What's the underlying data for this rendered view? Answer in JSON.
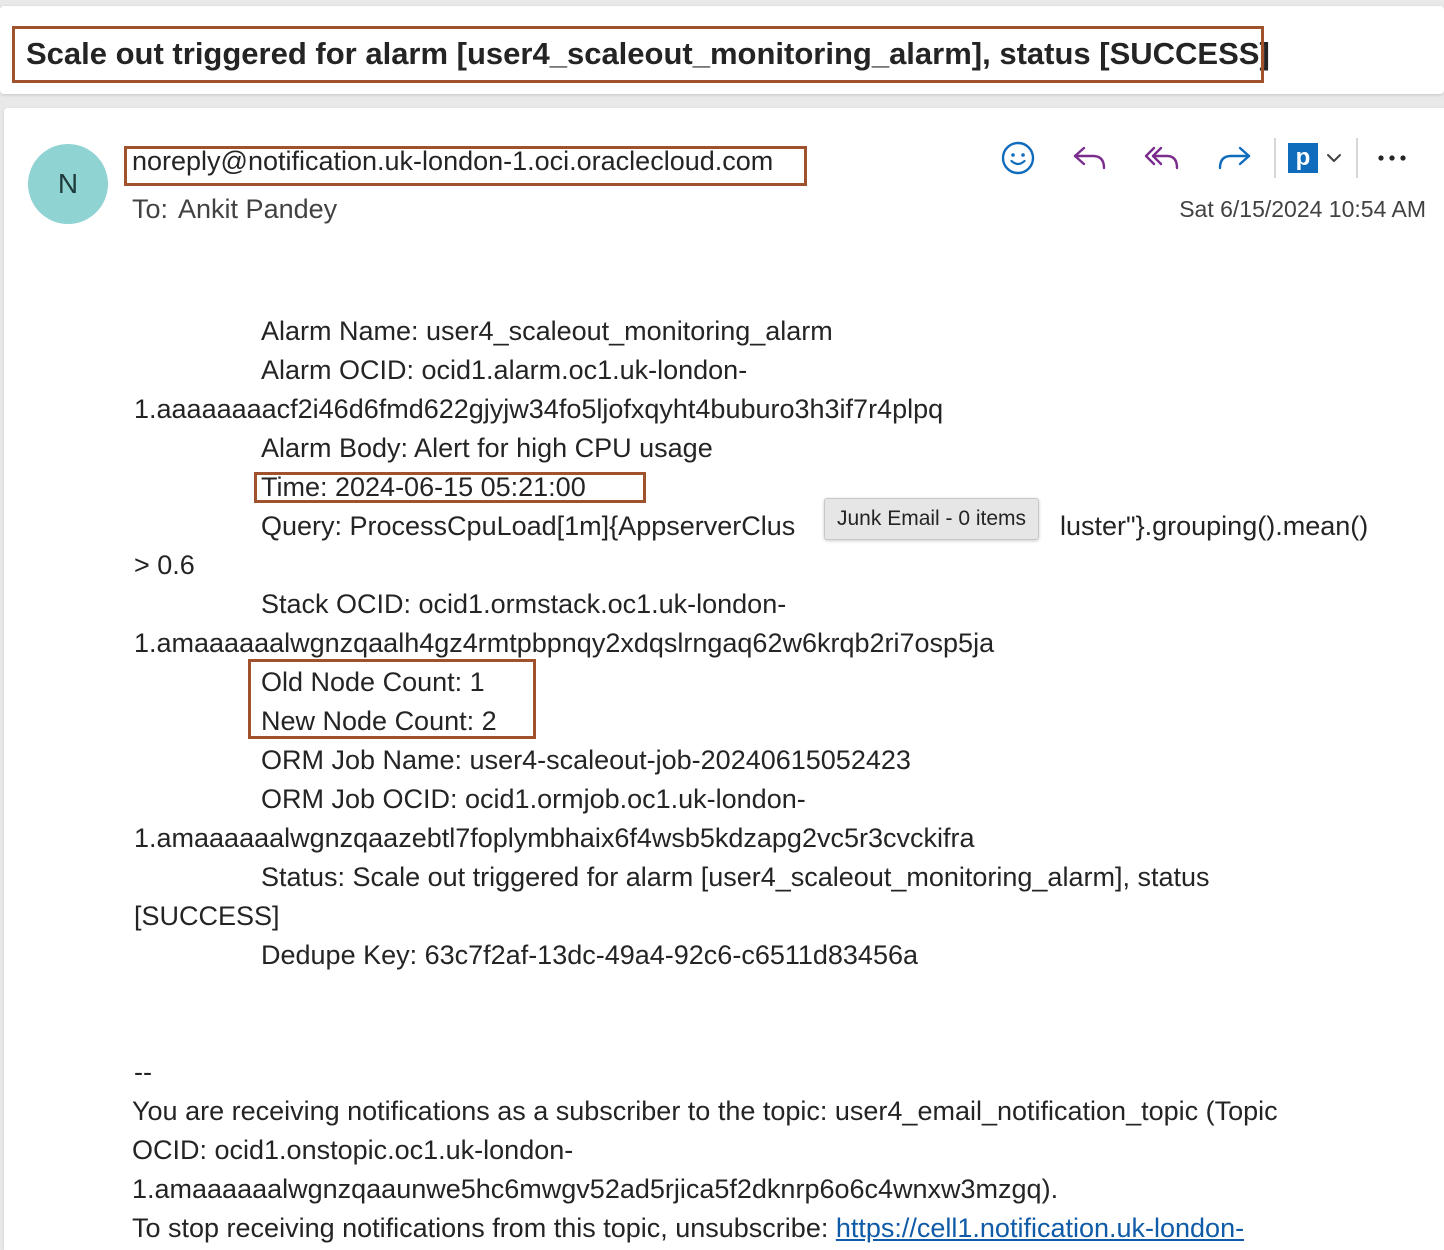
{
  "subject": "Scale out triggered for alarm [user4_scaleout_monitoring_alarm], status [SUCCESS]",
  "header": {
    "avatar_initial": "N",
    "sender": "noreply@notification.uk-london-1.oci.oraclecloud.com",
    "to_label": "To:",
    "to_name": "Ankit Pandey",
    "date": "Sat 6/15/2024 10:54 AM"
  },
  "actions": {
    "icons": [
      "emoji-icon",
      "reply-icon",
      "reply-all-icon",
      "forward-icon",
      "pingboard-p-icon",
      "chevron-down-icon",
      "more-icon"
    ],
    "p_label": "p",
    "more_label": "⋯",
    "accent": "#0f6cbd",
    "reply_color": "#7b2d8e"
  },
  "body": {
    "alarm_name": "Alarm Name: user4_scaleout_monitoring_alarm",
    "alarm_ocid_1": "Alarm OCID: ocid1.alarm.oc1.uk-london-",
    "alarm_ocid_2": "1.aaaaaaaacf2i46d6fmd622gjyjw34fo5ljofxqyht4buburo3h3if7r4plpq",
    "alarm_body": "Alarm Body: Alert for high CPU usage",
    "time": "Time: 2024-06-15 05:21:00",
    "query_1": "Query: ProcessCpuLoad[1m]{AppserverClus",
    "query_1b": "luster\"}.grouping().mean()",
    "query_2": "> 0.6",
    "stack_ocid_1": "Stack OCID: ocid1.ormstack.oc1.uk-london-",
    "stack_ocid_2": "1.amaaaaaalwgnzqaalh4gz4rmtpbpnqy2xdqslrngaq62w6krqb2ri7osp5ja",
    "old_node_count": "Old Node Count: 1",
    "new_node_count": "New Node Count: 2",
    "orm_job_name": "ORM Job Name: user4-scaleout-job-20240615052423",
    "orm_job_ocid_1": "ORM Job OCID: ocid1.ormjob.oc1.uk-london-",
    "orm_job_ocid_2": "1.amaaaaaalwgnzqaazebtl7foplymbhaix6f4wsb5kdzapg2vc5r3cvckifra",
    "status_1": "Status: Scale out triggered for alarm [user4_scaleout_monitoring_alarm], status",
    "status_2": "[SUCCESS]",
    "dedupe_key": "Dedupe Key: 63c7f2af-13dc-49a4-92c6-c6511d83456a",
    "sig_sep": "--",
    "footer_1": "You are receiving notifications as a subscriber to the topic: user4_email_notification_topic (Topic",
    "footer_2": "OCID: ocid1.onstopic.oc1.uk-london-",
    "footer_3": "1.amaaaaaalwgnzqaaunwe5hc6mwgv52ad5rjica5f2dknrp6o6c4wnxw3mzgq).",
    "footer_4": "To stop receiving notifications from this topic, unsubscribe: ",
    "unsubscribe_link": "https://cell1.notification.uk-london-"
  },
  "tooltip": "Junk Email - 0 items",
  "highlight_color": "#a0522d"
}
